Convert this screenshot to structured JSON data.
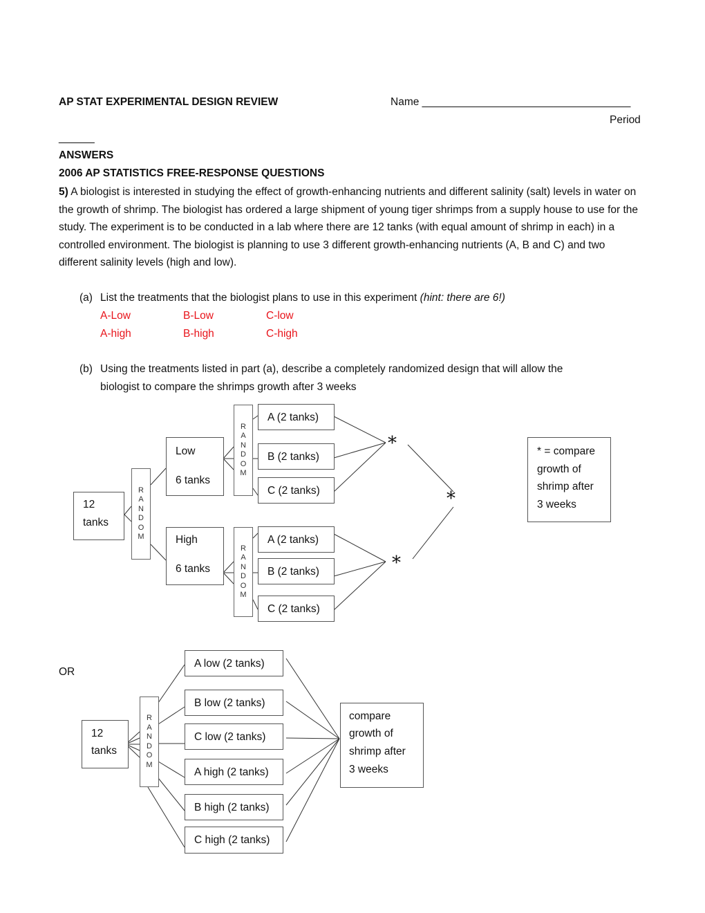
{
  "header": {
    "title": "AP STAT EXPERIMENTAL DESIGN REVIEW",
    "name_label": "Name ___________________________________",
    "period_label": "Period",
    "period_blank": "______",
    "answers": "ANSWERS",
    "source": "2006 AP STATISTICS FREE-RESPONSE QUESTIONS"
  },
  "question": {
    "number": "5)",
    "text": " A biologist is interested in studying the effect of growth-enhancing nutrients and different salinity (salt) levels in water on the growth of shrimp.  The biologist has ordered a large shipment of young tiger shrimps from a supply house to use for the study.  The experiment is to be conducted in a lab where there are 12 tanks (with equal amount of shrimp in each) in a controlled environment.   The biologist is planning to use 3 different growth-enhancing nutrients (A, B and C) and two different salinity levels (high and low)."
  },
  "part_a": {
    "label": "(a)",
    "text": "List the treatments that the biologist plans to use in this experiment ",
    "hint": "(hint: there are 6!)",
    "answers": [
      [
        "A-Low",
        "B-Low",
        "C-low"
      ],
      [
        "A-high",
        "B-high",
        "C-high"
      ]
    ]
  },
  "part_b": {
    "label": "(b)",
    "line1": "Using the treatments listed in part (a), describe a completely randomized design that will allow the",
    "line2": "biologist to compare the shrimps growth after 3 weeks"
  },
  "diagram1": {
    "start": [
      "12",
      "tanks"
    ],
    "random_letters": [
      "R",
      "A",
      "N",
      "D",
      "O",
      "M"
    ],
    "low": [
      "Low",
      "6 tanks"
    ],
    "high": [
      "High",
      "6 tanks"
    ],
    "low_groups": [
      "A (2 tanks)",
      "B (2 tanks)",
      "C (2 tanks)"
    ],
    "high_groups": [
      "A (2 tanks)",
      "B (2 tanks)",
      "C (2 tanks)"
    ],
    "star": "*",
    "legend": [
      "* = compare",
      "growth of",
      "shrimp after",
      "3 weeks"
    ]
  },
  "diagram2": {
    "or_label": "OR",
    "start": [
      "12",
      "tanks"
    ],
    "random_letters": [
      "R",
      "A",
      "N",
      "D",
      "O",
      "M"
    ],
    "groups": [
      "A low (2 tanks)",
      "B low (2 tanks)",
      "C  low (2 tanks)",
      "A high (2 tanks)",
      "B high (2 tanks)",
      "C high (2 tanks)"
    ],
    "result": [
      "compare",
      "growth of",
      "shrimp after",
      "3 weeks"
    ]
  }
}
